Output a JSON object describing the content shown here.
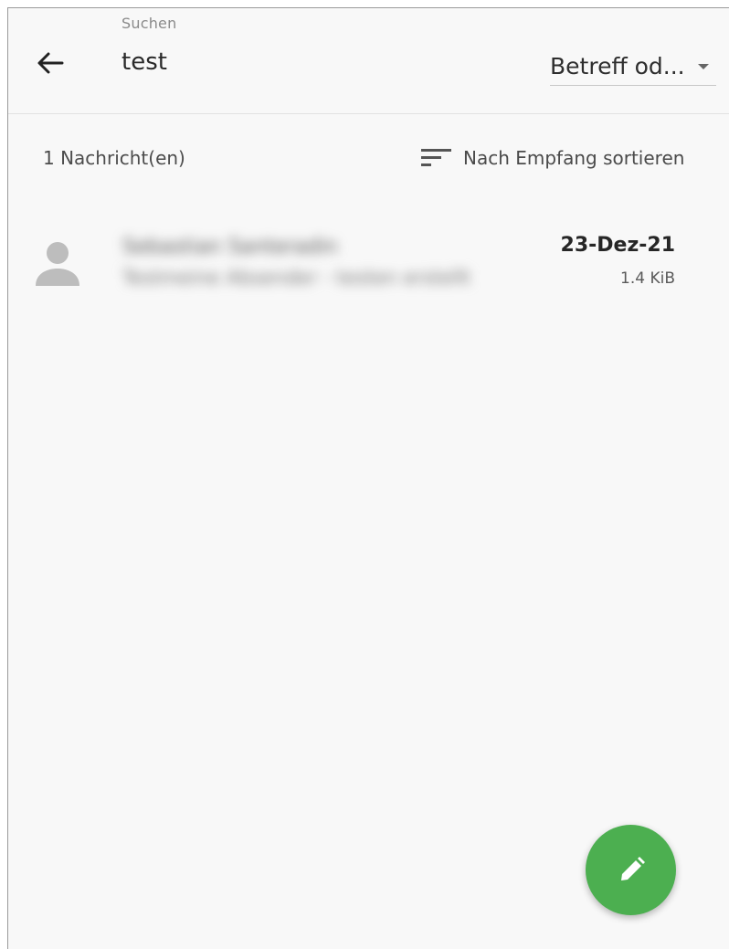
{
  "header": {
    "search_label": "Suchen",
    "search_value": "test",
    "filter_value": "Betreff od...",
    "back_icon": "arrow-left-icon"
  },
  "toolbar": {
    "message_count": "1 Nachricht(en)",
    "sort_label": "Nach Empfang sortieren",
    "sort_icon": "sort-icon"
  },
  "messages": [
    {
      "sender": "Sebastian Santeradin",
      "subject": "Testmeine Absender - testen erstellt",
      "date": "23-Dez-21",
      "size": "1.4 KiB",
      "avatar_icon": "person-icon"
    }
  ],
  "fab": {
    "icon": "pencil-icon",
    "color": "#4caf50"
  }
}
